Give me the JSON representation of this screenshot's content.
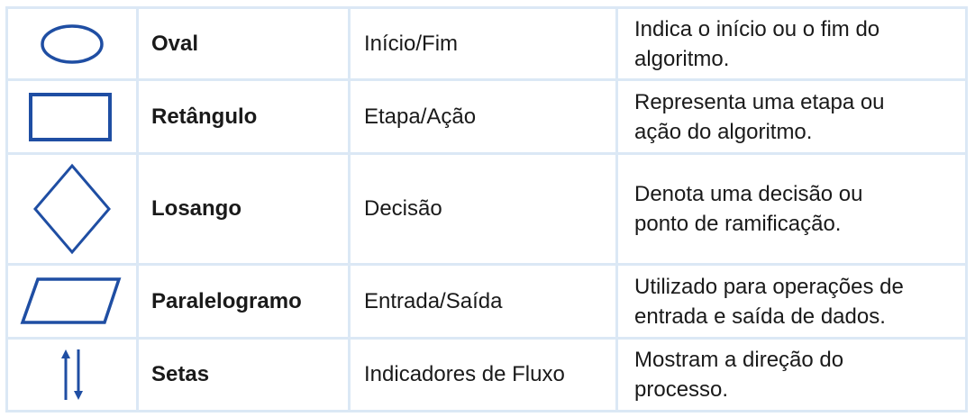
{
  "symbols": [
    {
      "icon": "oval-icon",
      "name": "Oval",
      "meaning": "Início/Fim",
      "description": [
        "Indica o início ou o fim do",
        "algoritmo."
      ]
    },
    {
      "icon": "rectangle-icon",
      "name": "Retângulo",
      "meaning": "Etapa/Ação",
      "description": [
        "Representa uma etapa ou",
        "ação do algoritmo."
      ]
    },
    {
      "icon": "diamond-icon",
      "name": "Losango",
      "meaning": "Decisão",
      "description": [
        "Denota uma decisão ou",
        "ponto de ramificação."
      ]
    },
    {
      "icon": "parallelogram-icon",
      "name": "Paralelogramo",
      "meaning": "Entrada/Saída",
      "description": [
        "Utilizado para operações de",
        "entrada e saída de dados."
      ]
    },
    {
      "icon": "arrows-icon",
      "name": "Setas",
      "meaning": "Indicadores de Fluxo",
      "description": [
        "Mostram a direção do",
        "processo."
      ]
    }
  ],
  "colors": {
    "shape_stroke": "#1f4ea3",
    "table_border": "#dbe8f5",
    "text": "#1a1a1a"
  }
}
